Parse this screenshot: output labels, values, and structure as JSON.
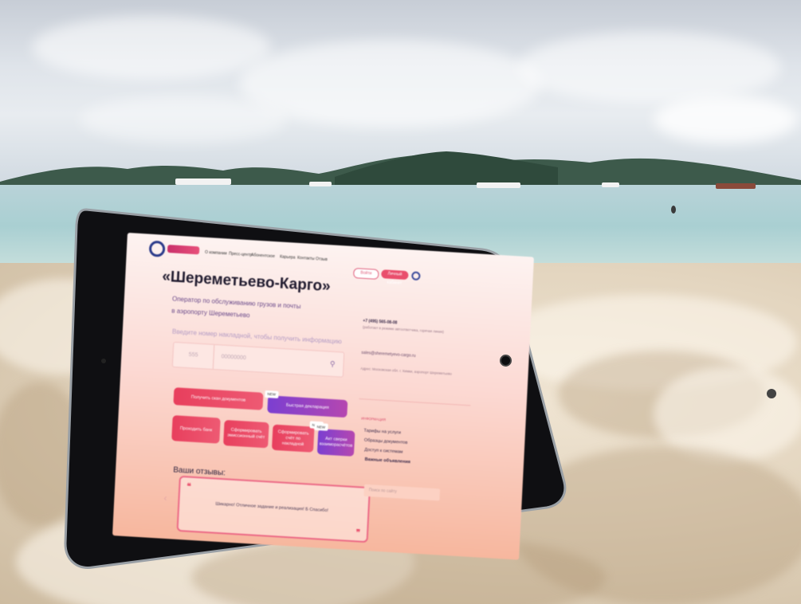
{
  "tablet_site": {
    "nav": [
      "О компании",
      "Пресс-центр",
      "Абонентское",
      "Карьера",
      "Контакты",
      "Отзыв"
    ],
    "header_buttons": {
      "outline": "Войти",
      "red": "Личный кабинет"
    },
    "title": "«Шереметьево-Карго»",
    "subtitle_line1": "Оператор по обслуживанию грузов и почты",
    "subtitle_line2": "в аэропорту Шереметьево",
    "search_hint": "Введите номер накладной, чтобы получить информацию",
    "search_prefix": "555",
    "search_placeholder": "00000000",
    "buttons": [
      {
        "label": "Получить скан документов",
        "style": "red"
      },
      {
        "label": "Быстрая декларация",
        "style": "violet",
        "tag": "NEW"
      },
      {
        "label": "Проходить банк",
        "style": "red"
      },
      {
        "label": "Сформировать эмиссионный счёт",
        "style": "red"
      },
      {
        "label": "Сформировать счёт по накладной",
        "style": "red",
        "tag": "NEW"
      },
      {
        "label": "Акт сверки взаиморасчётов",
        "style": "violet",
        "tag": "NEW"
      }
    ],
    "reviews_title": "Ваши отзывы:",
    "review_text": "Шикарно! Отличное задание и реализация! Б Спасибо!",
    "side": {
      "phone": "+7 (495) 565-08-08",
      "phone_note": "(работает в режиме автоответчика, горячая линия)",
      "email": "sales@sheremetyevo-cargo.ru",
      "address": "Адрес: Московская обл. г. Химки, аэропорт Шереметьево",
      "section": "ИНФОРМАЦИЯ",
      "links": [
        "Тарифы на услуги",
        "Образцы документов",
        "Доступ к системам",
        "Важные объявления"
      ],
      "select_placeholder": "Поиск по сайту"
    }
  }
}
